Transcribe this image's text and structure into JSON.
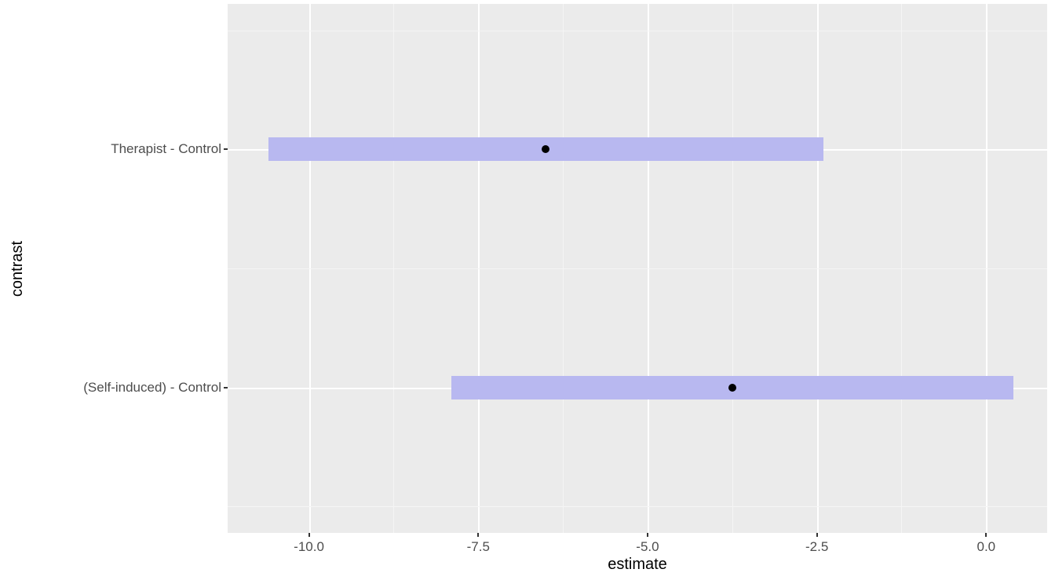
{
  "chart_data": {
    "type": "pointrange",
    "xlabel": "estimate",
    "ylabel": "contrast",
    "x_ticks": [
      -10.0,
      -7.5,
      -5.0,
      -2.5,
      0.0
    ],
    "x_range": [
      -11.2,
      0.9
    ],
    "categories": [
      "(Self-induced) - Control",
      "Therapist - Control"
    ],
    "series": [
      {
        "name": "(Self-induced) - Control",
        "estimate": -3.75,
        "lower": -7.9,
        "upper": 0.4
      },
      {
        "name": "Therapist - Control",
        "estimate": -6.5,
        "lower": -10.6,
        "upper": -2.4
      }
    ],
    "bar_color": "#b8b8f0",
    "point_color": "#000000"
  },
  "axis": {
    "xlabel": "estimate",
    "ylabel": "contrast",
    "xticks": {
      "t0": "-10.0",
      "t1": "-7.5",
      "t2": "-5.0",
      "t3": "-2.5",
      "t4": "0.0"
    },
    "yticks": {
      "c0": "(Self-induced) - Control",
      "c1": "Therapist - Control"
    }
  }
}
